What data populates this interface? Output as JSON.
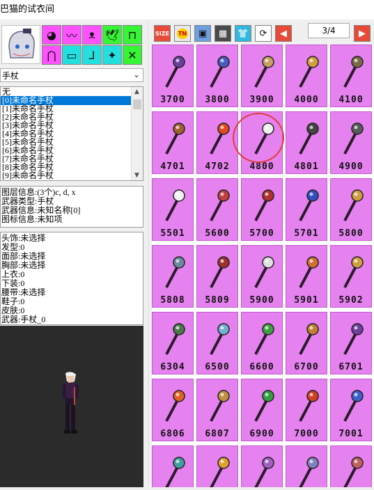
{
  "window": {
    "title": "巴猫的试衣间"
  },
  "categories": [
    {
      "name": "cat-ears",
      "icon": "ears-icon",
      "glyph": "◕"
    },
    {
      "name": "cat-hair",
      "icon": "hair-icon",
      "glyph": "〰"
    },
    {
      "name": "cat-face",
      "icon": "face-icon",
      "glyph": "ᴥ"
    },
    {
      "name": "cat-wings",
      "icon": "wings-icon",
      "glyph": "🕊"
    },
    {
      "name": "cat-shirt",
      "icon": "shirt-icon",
      "glyph": "⊓"
    },
    {
      "name": "cat-pants",
      "icon": "pants-icon",
      "glyph": "⋂"
    },
    {
      "name": "cat-belt",
      "icon": "belt-icon",
      "glyph": "▭"
    },
    {
      "name": "cat-shoes",
      "icon": "shoes-icon",
      "glyph": "⅃"
    },
    {
      "name": "cat-item",
      "icon": "item-icon",
      "glyph": "✦"
    },
    {
      "name": "cat-cross",
      "icon": "cross-icon",
      "glyph": "✕"
    }
  ],
  "weapon_select": {
    "value": "手杖"
  },
  "list": {
    "items": [
      "无",
      "[0]未命名手杖",
      "[1]未命名手杖",
      "[2]未命名手杖",
      "[3]未命名手杖",
      "[4]未命名手杖",
      "[5]未命名手杖",
      "[6]未命名手杖",
      "[7]未命名手杖",
      "[8]未命名手杖",
      "[9]未命名手杖"
    ],
    "selected_index": 1
  },
  "layer_info": {
    "lines": [
      "图层信息:(3个)c, d, x",
      "武器类型:手杖",
      "武器信息:未知名称[0]",
      "图标信息:未知项"
    ]
  },
  "equip_info": {
    "lines": [
      "头饰:未选择",
      "发型:0",
      "面部:未选择",
      "胸部:未选择",
      "上衣:0",
      "下装:0",
      "腰带:未选择",
      "鞋子:0",
      "皮肤:0",
      "武器:手杖_0"
    ]
  },
  "toolbar": {
    "buttons": [
      {
        "name": "size-icon",
        "label": "SIZE"
      },
      {
        "name": "tn-icon",
        "label": "TN"
      },
      {
        "name": "frame-icon",
        "label": "▣"
      },
      {
        "name": "film-icon",
        "label": "▦"
      },
      {
        "name": "shirt-tool-icon",
        "label": "👕"
      },
      {
        "name": "rotate-icon",
        "label": "⟳"
      },
      {
        "name": "prev-page-icon",
        "label": "◀"
      }
    ],
    "next_page_icon": "▶",
    "page": "3/4"
  },
  "grid": {
    "items": [
      "3700",
      "3800",
      "3900",
      "4000",
      "4100",
      "4701",
      "4702",
      "4800",
      "4801",
      "4900",
      "5501",
      "5600",
      "5700",
      "5701",
      "5800",
      "5808",
      "5809",
      "5900",
      "5901",
      "5902",
      "6304",
      "6500",
      "6600",
      "6700",
      "6701",
      "6806",
      "6807",
      "6900",
      "7000",
      "7001",
      "",
      "",
      "",
      "",
      ""
    ],
    "highlighted": "4800"
  },
  "colors": {
    "cell_bg": "#e582ef",
    "selection": "#0078d7",
    "highlight_circle": "#e23c3c"
  }
}
